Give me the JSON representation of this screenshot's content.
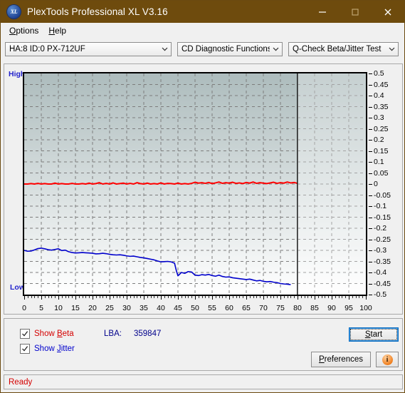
{
  "window": {
    "title": "PlexTools Professional XL V3.16",
    "icon": "XL",
    "minimize_icon": "minimize-icon",
    "maximize_icon": "maximize-icon",
    "close_icon": "close-icon",
    "titlebar_color": "#6e4b0d"
  },
  "menu": {
    "items": [
      {
        "label": "Options",
        "accel": "O"
      },
      {
        "label": "Help",
        "accel": "H"
      }
    ]
  },
  "toolbar": {
    "device_combo": {
      "value": "HA:8 ID:0  PX-712UF"
    },
    "function_combo": {
      "value": "CD Diagnostic Functions"
    },
    "test_combo": {
      "value": "Q-Check Beta/Jitter Test"
    }
  },
  "chart_panel": {
    "high_label": "High",
    "low_label": "Low"
  },
  "controls": {
    "show_beta": {
      "label_pre": "Show ",
      "label_accel": "B",
      "label_post": "eta",
      "checked": true,
      "color": "#d40000"
    },
    "show_jitter": {
      "label_pre": "Show ",
      "label_accel": "J",
      "label_post": "itter",
      "checked": true,
      "color": "#0000cc"
    },
    "lba_label": "LBA:",
    "lba_value": "359847",
    "start_button": {
      "pre": "",
      "accel": "S",
      "post": "tart"
    },
    "preferences_button": {
      "pre": "",
      "accel": "P",
      "post": "references"
    },
    "info_button": {
      "glyph": "i"
    }
  },
  "status": {
    "text": "Ready",
    "color": "#d40000"
  },
  "chart_data": {
    "type": "line",
    "title": "Q-Check Beta/Jitter Test",
    "xlabel": "",
    "ylabel": "",
    "xlim": [
      0,
      100
    ],
    "ylim": [
      -0.5,
      0.5
    ],
    "grid": true,
    "legend": "none",
    "data_end_marker_x": 80,
    "ytick_labels": [
      "0.5",
      "0.45",
      "0.4",
      "0.35",
      "0.3",
      "0.25",
      "0.2",
      "0.15",
      "0.1",
      "0.05",
      "0",
      "-0.05",
      "-0.1",
      "-0.15",
      "-0.2",
      "-0.25",
      "-0.3",
      "-0.35",
      "-0.4",
      "-0.45",
      "-0.5"
    ],
    "ytick_values": [
      0.5,
      0.45,
      0.4,
      0.35,
      0.3,
      0.25,
      0.2,
      0.15,
      0.1,
      0.05,
      0,
      -0.05,
      -0.1,
      -0.15,
      -0.2,
      -0.25,
      -0.3,
      -0.35,
      -0.4,
      -0.45,
      -0.5
    ],
    "xtick_labels": [
      "0",
      "5",
      "10",
      "15",
      "20",
      "25",
      "30",
      "35",
      "40",
      "45",
      "50",
      "55",
      "60",
      "65",
      "70",
      "75",
      "80",
      "85",
      "90",
      "95",
      "100"
    ],
    "xtick_values": [
      0,
      5,
      10,
      15,
      20,
      25,
      30,
      35,
      40,
      45,
      50,
      55,
      60,
      65,
      70,
      75,
      80,
      85,
      90,
      95,
      100
    ],
    "series": [
      {
        "name": "Beta",
        "color": "#ff0000",
        "x": [
          0,
          1,
          2,
          3,
          4,
          5,
          6,
          7,
          8,
          9,
          10,
          11,
          12,
          13,
          14,
          15,
          16,
          17,
          18,
          19,
          20,
          21,
          22,
          23,
          24,
          25,
          26,
          27,
          28,
          29,
          30,
          31,
          32,
          33,
          34,
          35,
          36,
          37,
          38,
          39,
          40,
          41,
          42,
          43,
          44,
          45,
          46,
          47,
          48,
          49,
          50,
          51,
          52,
          53,
          54,
          55,
          56,
          57,
          58,
          59,
          60,
          61,
          62,
          63,
          64,
          65,
          66,
          67,
          68,
          69,
          70,
          71,
          72,
          73,
          74,
          75,
          76,
          77,
          78,
          79,
          80
        ],
        "y": [
          0,
          0,
          0.002,
          0,
          0.003,
          0,
          0.002,
          0,
          0,
          0.004,
          0,
          0.002,
          0,
          0,
          0.003,
          0,
          0,
          0.002,
          0,
          0.004,
          0,
          0.002,
          0.006,
          0,
          0.003,
          0,
          0.005,
          0,
          0.002,
          0.004,
          0,
          0.003,
          0,
          0.006,
          0.002,
          0,
          0.004,
          0,
          0.002,
          0,
          0.005,
          0,
          0.003,
          0.002,
          0,
          0.004,
          0,
          0.002,
          0,
          0.003,
          0.008,
          0.004,
          0.006,
          0.003,
          0.007,
          0.002,
          0.005,
          0.009,
          0.003,
          0.006,
          0.004,
          0.008,
          0.003,
          0.005,
          0.002,
          0.007,
          0.004,
          0.009,
          0.003,
          0.006,
          0.004,
          0.002,
          0.005,
          0.008,
          0.003,
          0.006,
          0.004,
          0.009,
          0.005,
          0.007,
          0.003
        ]
      },
      {
        "name": "Jitter",
        "color": "#0000cc",
        "x": [
          0,
          1,
          2,
          3,
          4,
          5,
          6,
          7,
          8,
          9,
          10,
          11,
          12,
          13,
          14,
          15,
          16,
          17,
          18,
          19,
          20,
          21,
          22,
          23,
          24,
          25,
          26,
          27,
          28,
          29,
          30,
          31,
          32,
          33,
          34,
          35,
          36,
          37,
          38,
          39,
          40,
          41,
          42,
          43,
          44,
          44.5,
          45,
          45.5,
          46,
          47,
          48,
          49,
          50,
          51,
          52,
          53,
          54,
          55,
          56,
          57,
          58,
          59,
          60,
          61,
          62,
          63,
          64,
          65,
          66,
          67,
          68,
          69,
          70,
          71,
          72,
          73,
          74,
          75,
          76,
          77,
          78,
          79,
          80
        ],
        "y": [
          -0.3,
          -0.304,
          -0.303,
          -0.298,
          -0.292,
          -0.29,
          -0.293,
          -0.297,
          -0.299,
          -0.296,
          -0.293,
          -0.301,
          -0.299,
          -0.306,
          -0.31,
          -0.312,
          -0.311,
          -0.31,
          -0.311,
          -0.312,
          -0.313,
          -0.316,
          -0.315,
          -0.313,
          -0.315,
          -0.318,
          -0.32,
          -0.321,
          -0.32,
          -0.322,
          -0.325,
          -0.327,
          -0.326,
          -0.329,
          -0.332,
          -0.334,
          -0.337,
          -0.34,
          -0.343,
          -0.348,
          -0.352,
          -0.351,
          -0.35,
          -0.352,
          -0.358,
          -0.39,
          -0.415,
          -0.408,
          -0.4,
          -0.404,
          -0.396,
          -0.398,
          -0.412,
          -0.414,
          -0.41,
          -0.412,
          -0.409,
          -0.414,
          -0.417,
          -0.412,
          -0.418,
          -0.421,
          -0.42,
          -0.424,
          -0.426,
          -0.428,
          -0.43,
          -0.432,
          -0.43,
          -0.434,
          -0.438,
          -0.436,
          -0.44,
          -0.442,
          -0.441,
          -0.444,
          -0.446,
          -0.45,
          -0.452,
          -0.453,
          -0.455
        ]
      }
    ]
  }
}
